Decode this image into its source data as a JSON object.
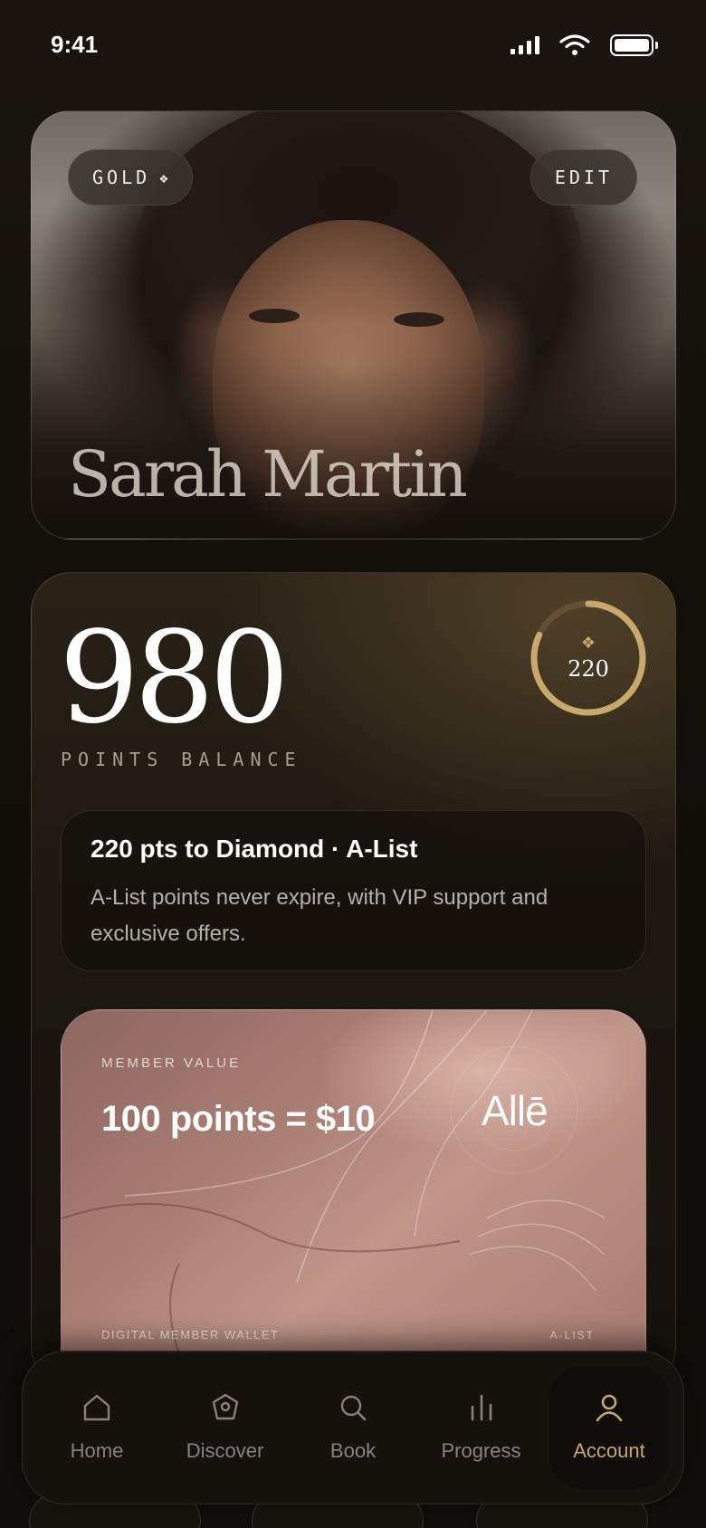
{
  "status_bar": {
    "time": "9:41"
  },
  "profile": {
    "tier_badge": "GOLD",
    "tier_glyph": "❖",
    "edit_label": "EDIT",
    "name": "Sarah Martin"
  },
  "points": {
    "balance": "980",
    "label": "POINTS BALANCE",
    "ring_glyph": "❖",
    "ring_value": "220",
    "ring_progress": 0.82
  },
  "tier": {
    "title": "220 pts to Diamond · A-List",
    "description": "A-List points never expire, with VIP support and exclusive offers."
  },
  "wallet": {
    "kicker": "MEMBER VALUE",
    "rate": "100 points = $10",
    "brand": "Allē",
    "footer_left": "DIGITAL MEMBER WALLET",
    "footer_right": "A-LIST"
  },
  "nav": {
    "items": [
      {
        "label": "Home",
        "icon": "home-icon"
      },
      {
        "label": "Discover",
        "icon": "discover-icon"
      },
      {
        "label": "Book",
        "icon": "search-icon"
      },
      {
        "label": "Progress",
        "icon": "progress-icon"
      },
      {
        "label": "Account",
        "icon": "account-icon",
        "active": true
      }
    ]
  },
  "colors": {
    "accent_gold": "#c9a86c",
    "background": "#16120d",
    "wallet_rose": "#b08a80"
  }
}
